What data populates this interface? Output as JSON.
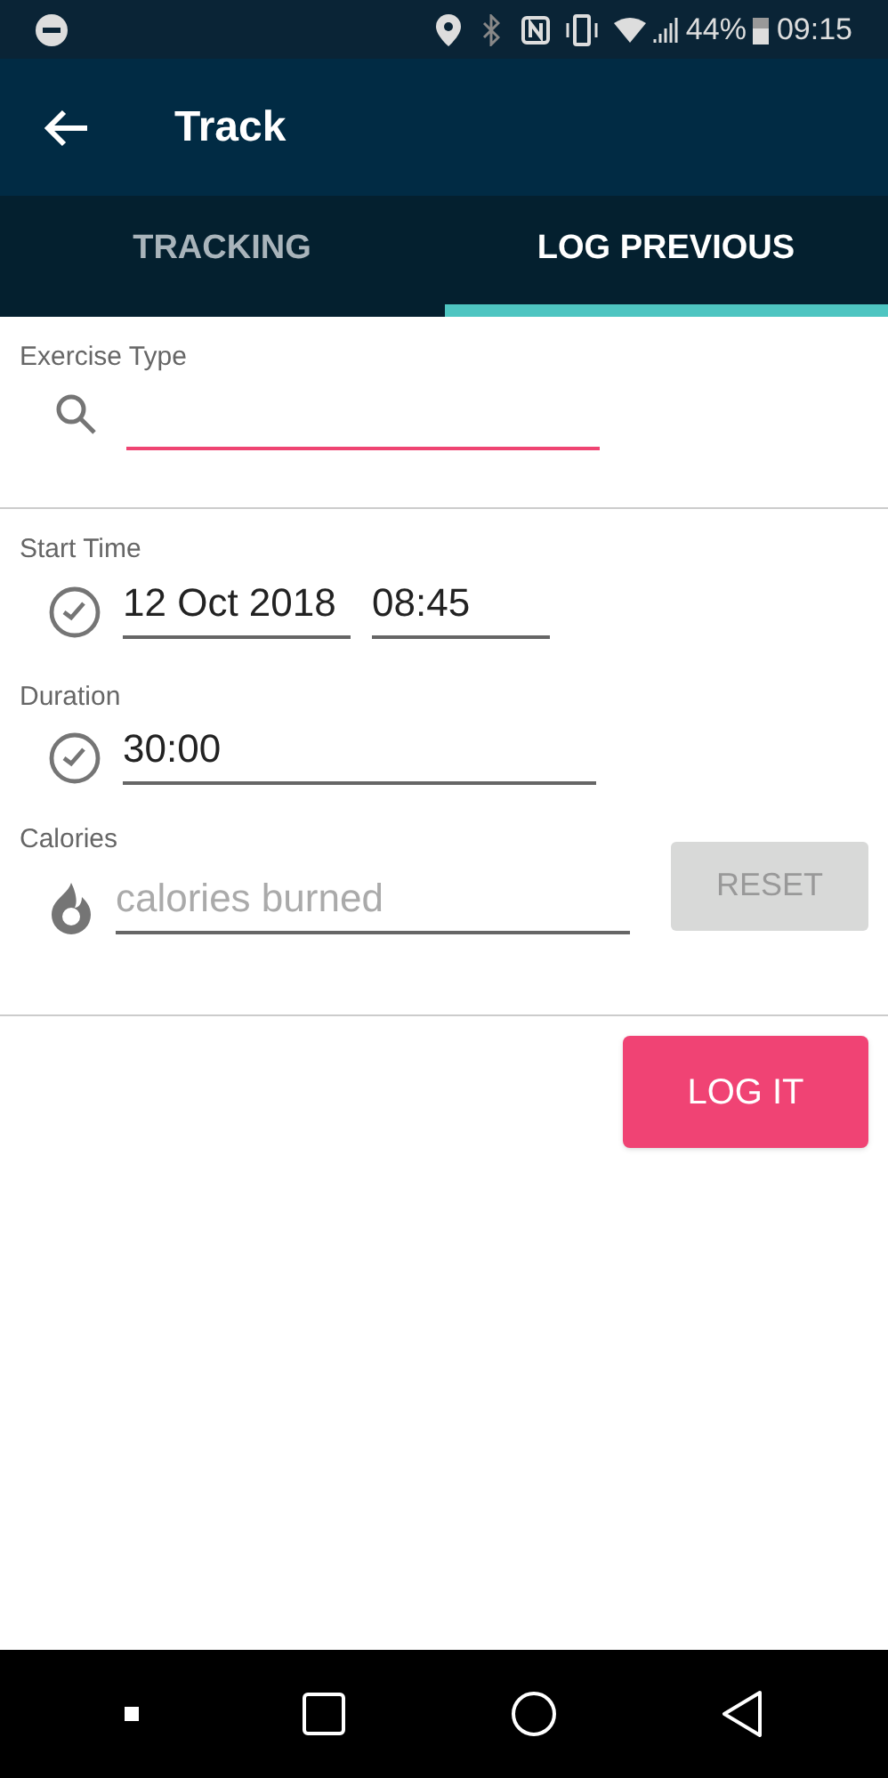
{
  "status_bar": {
    "battery": "44%",
    "time": "09:15"
  },
  "app_bar": {
    "title": "Track"
  },
  "tabs": [
    {
      "label": "TRACKING",
      "selected": false
    },
    {
      "label": "LOG PREVIOUS",
      "selected": true
    }
  ],
  "exercise_type": {
    "label": "Exercise Type",
    "focused": true
  },
  "start_time": {
    "label": "Start Time",
    "date": "12 Oct 2018",
    "time": "08:45"
  },
  "duration": {
    "label": "Duration",
    "value": "30:00"
  },
  "calories": {
    "label": "Calories",
    "placeholder": "calories burned",
    "reset": {
      "label": "RESET",
      "disabled": true
    }
  },
  "log_button": {
    "label": "LOG IT"
  }
}
